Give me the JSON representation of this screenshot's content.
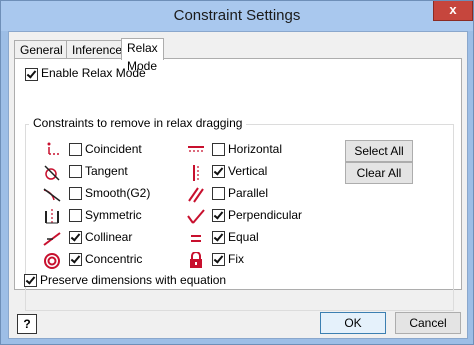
{
  "window": {
    "title": "Constraint Settings",
    "close_label": "x"
  },
  "tabs": [
    {
      "label": "General",
      "active": false
    },
    {
      "label": "Inference",
      "active": false
    },
    {
      "label": "Relax Mode",
      "active": true
    }
  ],
  "enable_relax": {
    "label": "Enable Relax Mode",
    "checked": true
  },
  "group": {
    "title": "Constraints to remove in relax dragging"
  },
  "constraints_left": [
    {
      "label": "Coincident",
      "checked": false,
      "icon": "coincident-icon"
    },
    {
      "label": "Tangent",
      "checked": false,
      "icon": "tangent-icon"
    },
    {
      "label": "Smooth(G2)",
      "checked": false,
      "icon": "smooth-icon"
    },
    {
      "label": "Symmetric",
      "checked": false,
      "icon": "symmetric-icon"
    },
    {
      "label": "Collinear",
      "checked": true,
      "icon": "collinear-icon"
    },
    {
      "label": "Concentric",
      "checked": true,
      "icon": "concentric-icon"
    }
  ],
  "constraints_right": [
    {
      "label": "Horizontal",
      "checked": false,
      "icon": "horizontal-icon"
    },
    {
      "label": "Vertical",
      "checked": true,
      "icon": "vertical-icon"
    },
    {
      "label": "Parallel",
      "checked": false,
      "icon": "parallel-icon"
    },
    {
      "label": "Perpendicular",
      "checked": true,
      "icon": "perpendicular-icon"
    },
    {
      "label": "Equal",
      "checked": true,
      "icon": "equal-icon"
    },
    {
      "label": "Fix",
      "checked": true,
      "icon": "fix-icon"
    }
  ],
  "buttons": {
    "select_all": "Select All",
    "clear_all": "Clear All",
    "ok": "OK",
    "cancel": "Cancel",
    "help": "?"
  },
  "preserve": {
    "label": "Preserve dimensions with equation",
    "checked": true
  },
  "colors": {
    "icon_red": "#c8102e",
    "title_bar": "#a9c8ee"
  }
}
